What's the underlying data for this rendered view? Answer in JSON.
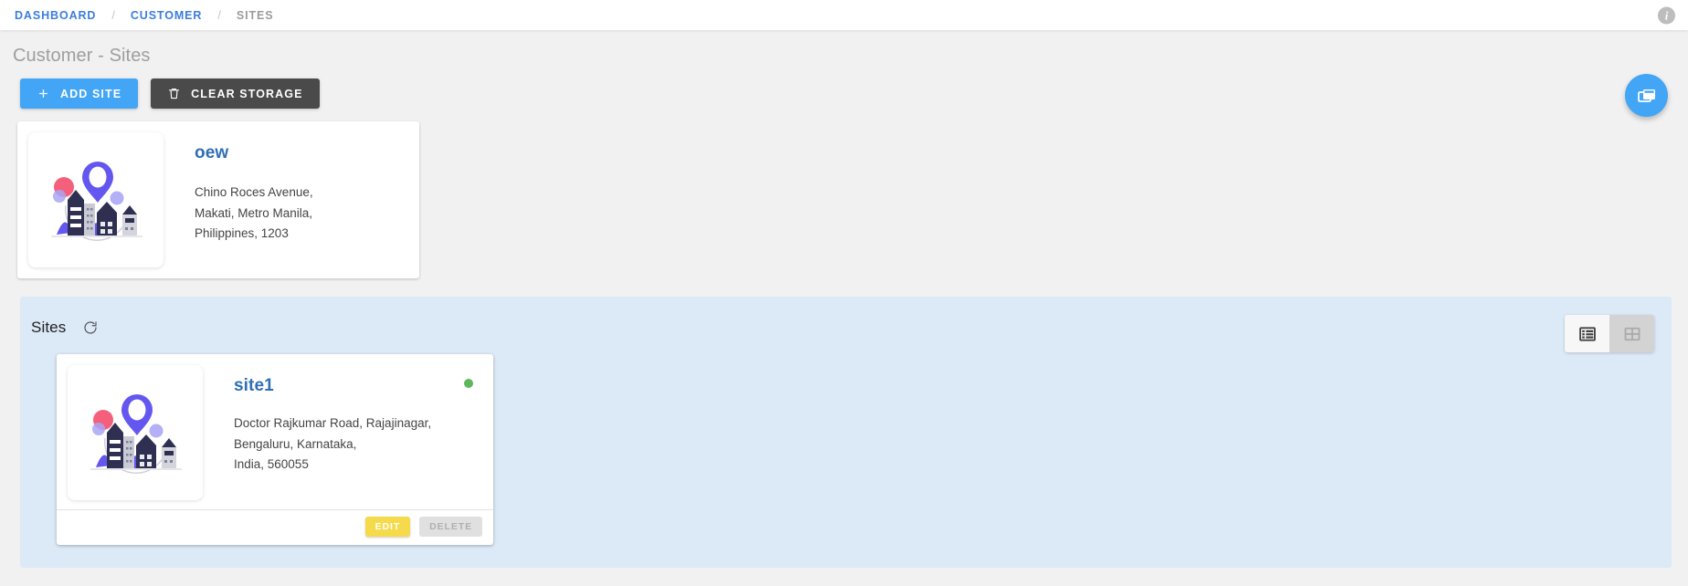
{
  "breadcrumb": {
    "items": [
      {
        "label": "DASHBOARD",
        "active": false
      },
      {
        "label": "CUSTOMER",
        "active": false
      },
      {
        "label": "SITES",
        "active": true
      }
    ],
    "separator": "/",
    "info_icon": "i"
  },
  "page": {
    "title": "Customer - Sites"
  },
  "toolbar": {
    "add_site_label": "ADD SITE",
    "clear_storage_label": "CLEAR STORAGE"
  },
  "customer_card": {
    "name": "oew",
    "address_lines": [
      "Chino Roces Avenue,",
      "Makati, Metro Manila,",
      "Philippines, 1203"
    ]
  },
  "sites_panel": {
    "title": "Sites",
    "view_list_label": "List view",
    "view_grid_label": "Grid view",
    "cards": [
      {
        "name": "site1",
        "address_lines": [
          "Doctor Rajkumar Road, Rajajinagar,",
          "Bengaluru, Karnataka,",
          "India, 560055"
        ],
        "status": "online",
        "edit_label": "EDIT",
        "delete_label": "DELETE"
      }
    ]
  },
  "colors": {
    "accent_blue": "#42a5f5",
    "link_blue": "#2f6fb3",
    "panel_blue": "#dce9f7",
    "dark_button": "#4a4a4a",
    "edit_yellow": "#f5da4b",
    "status_green": "#5cb85c",
    "page_background": "#f1f1f1"
  }
}
